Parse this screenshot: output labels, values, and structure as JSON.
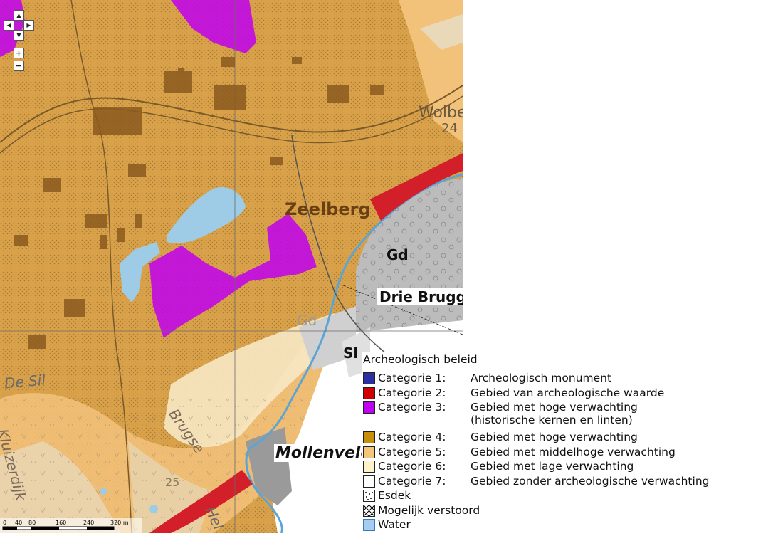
{
  "map": {
    "place_labels": {
      "zeelberg": "Zeelberg",
      "wolbe": "Wolbe",
      "wolbe_num": "24",
      "gd1": "Gd",
      "drie_brugge": "Drie Brugge",
      "gd2": "Gd",
      "sl": "Sl",
      "de_sil": "De Sil",
      "brugse": "Brugse",
      "kluizerdijk": "Kluizerdijk",
      "mollenveld": "Mollenveld",
      "num25": "25",
      "hel": "Hel"
    },
    "colors": {
      "cat4": "#d9a24a",
      "cat5": "#f2c27b",
      "cat6": "#f7e8c4",
      "cat3": "#c000f0",
      "cat2": "#d21f2a",
      "water": "#9ecbe6",
      "built": "#8b5a1e",
      "grey_area": "#bcbcbc"
    }
  },
  "navigation": {
    "pan_up": "▲",
    "pan_left": "◀",
    "pan_right": "▶",
    "pan_down": "▼",
    "zoom_in": "+",
    "zoom_out": "−"
  },
  "scalebar": {
    "ticks": [
      "0",
      "40",
      "80",
      "160",
      "240",
      "320 m"
    ]
  },
  "legend": {
    "title": "Archeologisch beleid",
    "items": [
      {
        "category": "Categorie 1:",
        "description": "Archeologisch monument",
        "color": "#2b2fa0"
      },
      {
        "category": "Categorie 2:",
        "description": "Gebied van archeologische waarde",
        "color": "#d00000"
      },
      {
        "category": "Categorie 3:",
        "description": "Gebied met hoge verwachting",
        "description_line2": "(historische kernen en linten)",
        "color": "#c000f0"
      },
      {
        "category": "Categorie 4:",
        "description": "Gebied met hoge verwachting",
        "color": "#c8900a"
      },
      {
        "category": "Categorie 5:",
        "description": "Gebied met middelhoge verwachting",
        "color": "#f5c57a"
      },
      {
        "category": "Categorie 6:",
        "description": "Gebied met lage verwachting",
        "color": "#fdf3c8"
      },
      {
        "category": "Categorie 7:",
        "description": "Gebied zonder archeologische verwachting",
        "color": "#ffffff"
      },
      {
        "category": "Esdek",
        "description": "",
        "color": "#ffffff"
      },
      {
        "category": "Mogelijk verstoord",
        "description": "",
        "color": "#ffffff"
      },
      {
        "category": "Water",
        "description": "",
        "color": "#a4cdf0"
      }
    ]
  }
}
